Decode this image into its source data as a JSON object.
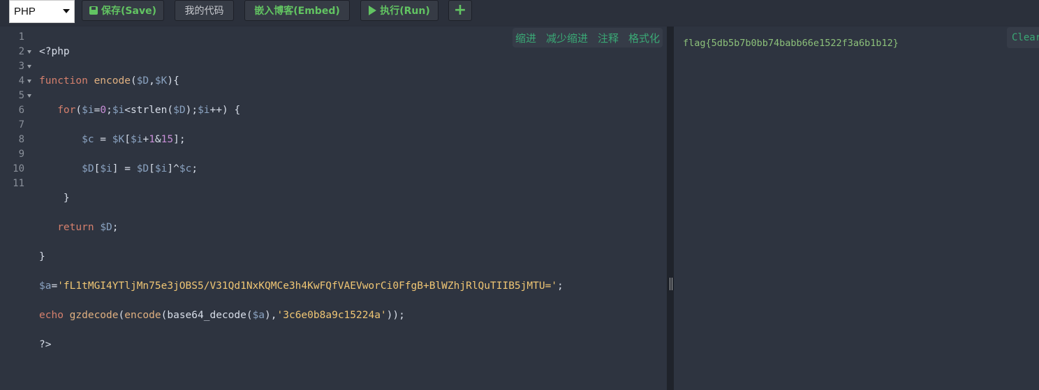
{
  "toolbar": {
    "language": "PHP",
    "save_label": "保存(Save)",
    "my_code_label": "我的代码",
    "embed_label": "嵌入博客(Embed)",
    "run_label": "执行(Run)",
    "add_label": "+"
  },
  "editor": {
    "line_numbers": [
      "1",
      "2",
      "3",
      "4",
      "5",
      "6",
      "7",
      "8",
      "9",
      "10",
      "11"
    ],
    "tools": [
      "缩进",
      "减少缩进",
      "注释",
      "格式化"
    ],
    "code": {
      "l1": "<?php",
      "l2_kw": "function",
      "l2_fn": "encode",
      "l2_a": "(",
      "l2_v1": "$D",
      "l2_b": ",",
      "l2_v2": "$K",
      "l2_c": "){",
      "l3_kw": "for",
      "l3_a": "(",
      "l3_v1": "$i",
      "l3_b": "=",
      "l3_n1": "0",
      "l3_c": ";",
      "l3_v2": "$i",
      "l3_d": "<strlen(",
      "l3_v3": "$D",
      "l3_e": ");",
      "l3_v4": "$i",
      "l3_f": "++) {",
      "l4_v1": "$c",
      "l4_a": " = ",
      "l4_v2": "$K",
      "l4_b": "[",
      "l4_v3": "$i",
      "l4_c": "+",
      "l4_n1": "1",
      "l4_d": "&",
      "l4_n2": "15",
      "l4_e": "];",
      "l5_v1": "$D",
      "l5_a": "[",
      "l5_v2": "$i",
      "l5_b": "] = ",
      "l5_v3": "$D",
      "l5_c": "[",
      "l5_v4": "$i",
      "l5_d": "]^",
      "l5_v5": "$c",
      "l5_e": ";",
      "l6": "}",
      "l7_kw": "return",
      "l7_v": "$D",
      "l7_a": ";",
      "l8": "}",
      "l9_v": "$a",
      "l9_a": "=",
      "l9_s": "'fL1tMGI4YTljMn75e3jOBS5/V31Qd1NxKQMCe3h4KwFQfVAEVworCi0FfgB+BlWZhjRlQuTIIB5jMTU='",
      "l9_b": ";",
      "l10_kw": "echo",
      "l10_fn1": "gzdecode",
      "l10_a": "(",
      "l10_fn2": "encode",
      "l10_b": "(base64_decode(",
      "l10_v": "$a",
      "l10_c": "),",
      "l10_s": "'3c6e0b8a9c15224a'",
      "l10_d": "));",
      "l11": "?>"
    }
  },
  "output": {
    "text": "flag{5db5b7b0bb74babb66e1522f3a6b1b12}",
    "clear_label": "Clear"
  },
  "colors": {
    "accent": "#62c462",
    "tool_link": "#3aa875",
    "editor_bg": "#2e3440"
  }
}
